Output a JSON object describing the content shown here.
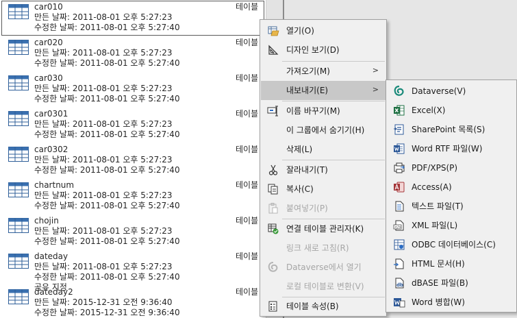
{
  "tables": [
    {
      "name": "car010",
      "created": "만든 날짜: 2011-08-01 오후 5:27:23",
      "modified": "수정한 날짜: 2011-08-01 오후 5:27:40",
      "type": "테이블"
    },
    {
      "name": "car020",
      "created": "만든 날짜: 2011-08-01 오후 5:27:23",
      "modified": "수정한 날짜: 2011-08-01 오후 5:27:40",
      "type": "테이블"
    },
    {
      "name": "car030",
      "created": "만든 날짜: 2011-08-01 오후 5:27:23",
      "modified": "수정한 날짜: 2011-08-01 오후 5:27:40",
      "type": "테이블"
    },
    {
      "name": "car0301",
      "created": "만든 날짜: 2011-08-01 오후 5:27:23",
      "modified": "수정한 날짜: 2011-08-01 오후 5:27:40",
      "type": "테이블"
    },
    {
      "name": "car0302",
      "created": "만든 날짜: 2011-08-01 오후 5:27:23",
      "modified": "수정한 날짜: 2011-08-01 오후 5:27:40",
      "type": "테이블"
    },
    {
      "name": "chartnum",
      "created": "만든 날짜: 2011-08-01 오후 5:27:23",
      "modified": "수정한 날짜: 2011-08-01 오후 5:27:40",
      "type": "테이블"
    },
    {
      "name": "chojin",
      "created": "만든 날짜: 2011-08-01 오후 5:27:23",
      "modified": "수정한 날짜: 2011-08-01 오후 5:27:40",
      "type": "테이블"
    },
    {
      "name": "dateday",
      "created": "만든 날짜: 2011-08-01 오후 5:27:23",
      "modified": "수정한 날짜: 2011-08-01 오후 5:27:40",
      "extra": "공유 지정",
      "type": "테이블"
    },
    {
      "name": "dateday2",
      "created": "만든 날짜: 2015-12-31 오전 9:36:40",
      "modified": "수정한 날짜: 2015-12-31 오전 9:36:40",
      "type": "테이블"
    }
  ],
  "context_menu": {
    "open": "열기(O)",
    "design_view": "디자인 보기(D)",
    "import": "가져오기(M)",
    "export": "내보내기(E)",
    "rename": "이름 바꾸기(M)",
    "hide": "이 그룹에서 숨기기(H)",
    "delete": "삭제(L)",
    "cut": "잘라내기(T)",
    "copy": "복사(C)",
    "paste": "붙여넣기(P)",
    "linked_table_manager": "연결 테이블 관리자(K)",
    "refresh_link": "링크 새로 고침(R)",
    "open_in_dataverse": "Dataverse에서 열기",
    "convert_local": "로컬 테이블로 변환(V)",
    "table_properties": "테이블 속성(B)"
  },
  "export_menu": {
    "dataverse": "Dataverse(V)",
    "excel": "Excel(X)",
    "sharepoint": "SharePoint 목록(S)",
    "word_rtf": "Word RTF 파일(W)",
    "pdf_xps": "PDF/XPS(P)",
    "access": "Access(A)",
    "text": "텍스트 파일(T)",
    "xml": "XML 파일(L)",
    "odbc": "ODBC 데이터베이스(C)",
    "html": "HTML 문서(H)",
    "dbase": "dBASE 파일(B)",
    "word_merge": "Word 병합(W)"
  },
  "icons": {
    "open": "open-table-icon",
    "design": "design-view-icon",
    "rename": "rename-icon",
    "cut": "scissors-icon",
    "copy": "copy-icon",
    "paste": "paste-icon",
    "link_manager": "linked-table-manager-icon",
    "dataverse": "dataverse-icon",
    "properties": "properties-icon"
  }
}
